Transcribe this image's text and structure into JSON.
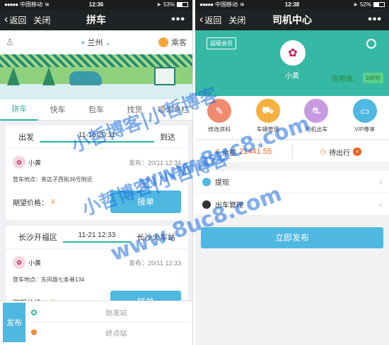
{
  "left": {
    "status": {
      "carrier": "中国移动",
      "time": "12:36",
      "battery": "53%",
      "battery_level": 0.53
    },
    "nav": {
      "back": "返回",
      "close": "关闭",
      "title": "拼车",
      "more": "•••"
    },
    "city": "兰州",
    "role": "乘客",
    "tabs": [
      "拼车",
      "快车",
      "包车",
      "找货",
      "顺丰专栏"
    ],
    "cards": [
      {
        "from_label": "出发",
        "time": "11-16 20:11",
        "to_label": "到达",
        "user": "小黄",
        "published": "发布：20/11 12:34",
        "pickup": "登车地点：茶店子西街36号附近",
        "price_label": "期望价格：",
        "price": "¥",
        "order": "接单"
      },
      {
        "from_label": "长沙开福区",
        "time": "11-21 12:33",
        "to_label": "长沙火车站",
        "user": "小黄",
        "published": "发布：20/11 12:33",
        "pickup": "登车地点：东风路七条巷134",
        "price_label": "期望价格：",
        "price": "¥",
        "order": "接单"
      }
    ],
    "publish": "发布",
    "start_station": "始发站",
    "end_station": "终点站"
  },
  "right": {
    "status": {
      "carrier": "中国移动",
      "time": "12:38",
      "battery": "52%",
      "battery_level": 0.52
    },
    "nav": {
      "back": "返回",
      "close": "关闭",
      "title": "司机中心",
      "more": "•••"
    },
    "vip": "超级会员",
    "name": "小黄",
    "credit_label": "信用值：",
    "credit_value": "100分",
    "grid": [
      "修改资料",
      "车辆管理",
      "司机出车",
      "VIP尊享"
    ],
    "balance_label": "余额",
    "balance": "21441.55",
    "pending_label": "待出行",
    "pending_count": "4",
    "menu": [
      "提现",
      "出车管理"
    ],
    "publish_now": "立即发布"
  },
  "watermark": [
    "小哲博客|小哲博客",
    "www.8uc8.com",
    "小哲博客|小哲博客",
    "www.8uc8.com"
  ]
}
